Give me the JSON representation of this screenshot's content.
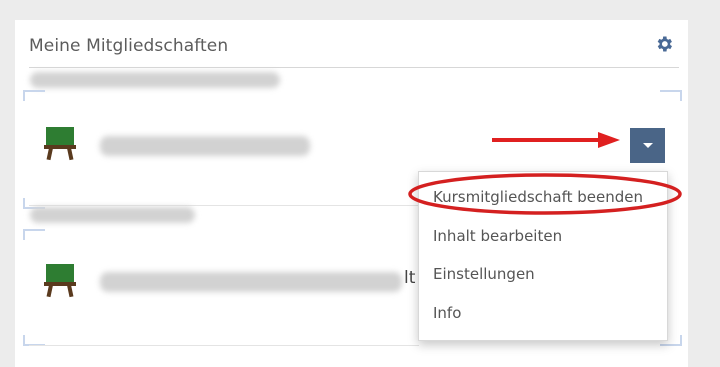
{
  "widget": {
    "title": "Meine Mitgliedschaften",
    "settings_icon": "gear-icon"
  },
  "courses": [
    {
      "icon": "blackboard-icon",
      "title_visible_suffix": ""
    },
    {
      "icon": "blackboard-icon",
      "title_visible_suffix": "lt"
    }
  ],
  "dropdown": {
    "toggle_icon": "caret-down-icon",
    "items": [
      "Kursmitgliedschaft beenden",
      "Inhalt bearbeiten",
      "Einstellungen",
      "Info"
    ]
  },
  "annotations": {
    "arrow_color": "#e02020",
    "highlight_color": "#d42020"
  },
  "colors": {
    "button_bg": "#4a6587",
    "icon_green": "#2e7d32",
    "icon_brown": "#5a3a1e"
  }
}
